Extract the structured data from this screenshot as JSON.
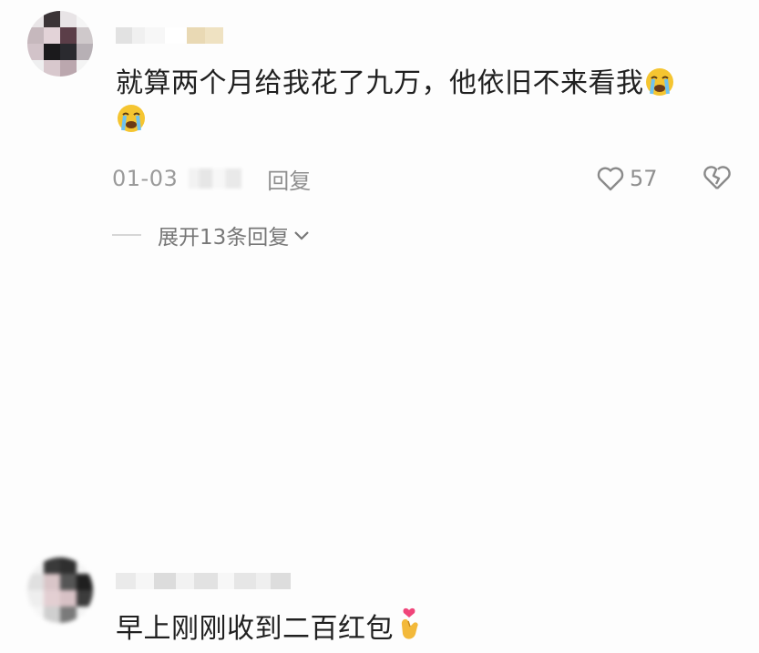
{
  "comments": [
    {
      "text": "就算两个月给我花了九万，他依旧不来看我",
      "date": "01-03",
      "reply_label": "回复",
      "likes": "57",
      "expand_label": "展开13条回复",
      "emoji": "loudly-crying-face-icon"
    },
    {
      "text": "早上刚刚收到二百红包",
      "emoji": "heart-hands-icon"
    }
  ],
  "colors": {
    "text": "#202020",
    "meta": "#9a9a9a",
    "background": "#fdfdfd"
  }
}
